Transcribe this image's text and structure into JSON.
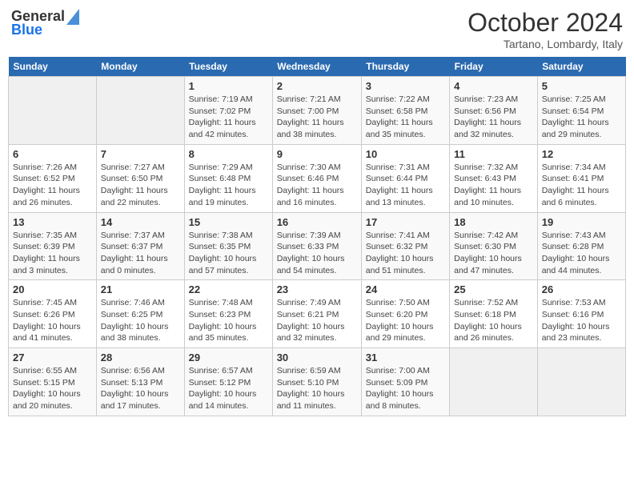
{
  "header": {
    "logo_general": "General",
    "logo_blue": "Blue",
    "month": "October 2024",
    "location": "Tartano, Lombardy, Italy"
  },
  "weekdays": [
    "Sunday",
    "Monday",
    "Tuesday",
    "Wednesday",
    "Thursday",
    "Friday",
    "Saturday"
  ],
  "weeks": [
    [
      {
        "day": "",
        "info": ""
      },
      {
        "day": "",
        "info": ""
      },
      {
        "day": "1",
        "info": "Sunrise: 7:19 AM\nSunset: 7:02 PM\nDaylight: 11 hours and 42 minutes."
      },
      {
        "day": "2",
        "info": "Sunrise: 7:21 AM\nSunset: 7:00 PM\nDaylight: 11 hours and 38 minutes."
      },
      {
        "day": "3",
        "info": "Sunrise: 7:22 AM\nSunset: 6:58 PM\nDaylight: 11 hours and 35 minutes."
      },
      {
        "day": "4",
        "info": "Sunrise: 7:23 AM\nSunset: 6:56 PM\nDaylight: 11 hours and 32 minutes."
      },
      {
        "day": "5",
        "info": "Sunrise: 7:25 AM\nSunset: 6:54 PM\nDaylight: 11 hours and 29 minutes."
      }
    ],
    [
      {
        "day": "6",
        "info": "Sunrise: 7:26 AM\nSunset: 6:52 PM\nDaylight: 11 hours and 26 minutes."
      },
      {
        "day": "7",
        "info": "Sunrise: 7:27 AM\nSunset: 6:50 PM\nDaylight: 11 hours and 22 minutes."
      },
      {
        "day": "8",
        "info": "Sunrise: 7:29 AM\nSunset: 6:48 PM\nDaylight: 11 hours and 19 minutes."
      },
      {
        "day": "9",
        "info": "Sunrise: 7:30 AM\nSunset: 6:46 PM\nDaylight: 11 hours and 16 minutes."
      },
      {
        "day": "10",
        "info": "Sunrise: 7:31 AM\nSunset: 6:44 PM\nDaylight: 11 hours and 13 minutes."
      },
      {
        "day": "11",
        "info": "Sunrise: 7:32 AM\nSunset: 6:43 PM\nDaylight: 11 hours and 10 minutes."
      },
      {
        "day": "12",
        "info": "Sunrise: 7:34 AM\nSunset: 6:41 PM\nDaylight: 11 hours and 6 minutes."
      }
    ],
    [
      {
        "day": "13",
        "info": "Sunrise: 7:35 AM\nSunset: 6:39 PM\nDaylight: 11 hours and 3 minutes."
      },
      {
        "day": "14",
        "info": "Sunrise: 7:37 AM\nSunset: 6:37 PM\nDaylight: 11 hours and 0 minutes."
      },
      {
        "day": "15",
        "info": "Sunrise: 7:38 AM\nSunset: 6:35 PM\nDaylight: 10 hours and 57 minutes."
      },
      {
        "day": "16",
        "info": "Sunrise: 7:39 AM\nSunset: 6:33 PM\nDaylight: 10 hours and 54 minutes."
      },
      {
        "day": "17",
        "info": "Sunrise: 7:41 AM\nSunset: 6:32 PM\nDaylight: 10 hours and 51 minutes."
      },
      {
        "day": "18",
        "info": "Sunrise: 7:42 AM\nSunset: 6:30 PM\nDaylight: 10 hours and 47 minutes."
      },
      {
        "day": "19",
        "info": "Sunrise: 7:43 AM\nSunset: 6:28 PM\nDaylight: 10 hours and 44 minutes."
      }
    ],
    [
      {
        "day": "20",
        "info": "Sunrise: 7:45 AM\nSunset: 6:26 PM\nDaylight: 10 hours and 41 minutes."
      },
      {
        "day": "21",
        "info": "Sunrise: 7:46 AM\nSunset: 6:25 PM\nDaylight: 10 hours and 38 minutes."
      },
      {
        "day": "22",
        "info": "Sunrise: 7:48 AM\nSunset: 6:23 PM\nDaylight: 10 hours and 35 minutes."
      },
      {
        "day": "23",
        "info": "Sunrise: 7:49 AM\nSunset: 6:21 PM\nDaylight: 10 hours and 32 minutes."
      },
      {
        "day": "24",
        "info": "Sunrise: 7:50 AM\nSunset: 6:20 PM\nDaylight: 10 hours and 29 minutes."
      },
      {
        "day": "25",
        "info": "Sunrise: 7:52 AM\nSunset: 6:18 PM\nDaylight: 10 hours and 26 minutes."
      },
      {
        "day": "26",
        "info": "Sunrise: 7:53 AM\nSunset: 6:16 PM\nDaylight: 10 hours and 23 minutes."
      }
    ],
    [
      {
        "day": "27",
        "info": "Sunrise: 6:55 AM\nSunset: 5:15 PM\nDaylight: 10 hours and 20 minutes."
      },
      {
        "day": "28",
        "info": "Sunrise: 6:56 AM\nSunset: 5:13 PM\nDaylight: 10 hours and 17 minutes."
      },
      {
        "day": "29",
        "info": "Sunrise: 6:57 AM\nSunset: 5:12 PM\nDaylight: 10 hours and 14 minutes."
      },
      {
        "day": "30",
        "info": "Sunrise: 6:59 AM\nSunset: 5:10 PM\nDaylight: 10 hours and 11 minutes."
      },
      {
        "day": "31",
        "info": "Sunrise: 7:00 AM\nSunset: 5:09 PM\nDaylight: 10 hours and 8 minutes."
      },
      {
        "day": "",
        "info": ""
      },
      {
        "day": "",
        "info": ""
      }
    ]
  ]
}
